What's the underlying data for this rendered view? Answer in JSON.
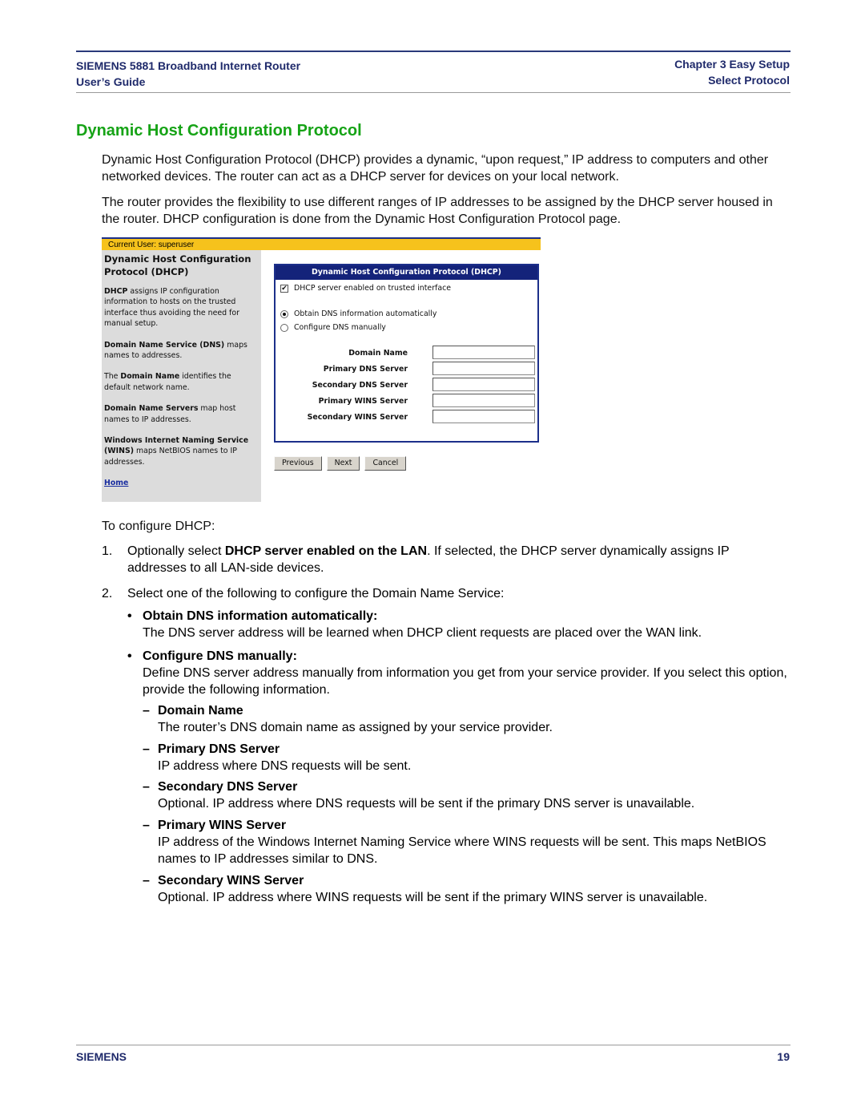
{
  "header": {
    "left_line1": "SIEMENS 5881 Broadband Internet Router",
    "left_line2": "User’s Guide",
    "right_line1": "Chapter 3  Easy Setup",
    "right_line2": "Select Protocol"
  },
  "section_title": "Dynamic Host Configuration Protocol",
  "intro": [
    "Dynamic Host Configuration Protocol (DHCP) provides a dynamic, “upon request,” IP address to computers and other networked devices. The router can act as a DHCP server for devices on your local network.",
    "The router provides the flexibility to use different ranges of IP addresses to be assigned by the DHCP server housed in the router. DHCP configuration is done from the Dynamic Host Configuration Protocol page."
  ],
  "screenshot": {
    "current_user": "Current User: superuser",
    "sidebar": {
      "title": "Dynamic Host Configuration Protocol (DHCP)",
      "paragraphs": [
        {
          "bold": "DHCP",
          "text": " assigns IP configuration information to hosts on the trusted interface thus avoiding the need for manual setup."
        },
        {
          "bold": "Domain Name Service (DNS)",
          "text": " maps names to addresses."
        },
        {
          "prefix": "The ",
          "bold": "Domain Name",
          "text": " identifies the default network name."
        },
        {
          "bold": "Domain Name Servers",
          "text": " map host names to IP addresses."
        },
        {
          "bold": "Windows Internet Naming Service (WINS)",
          "text": " maps NetBIOS names to IP addresses."
        }
      ],
      "home_link": "Home"
    },
    "panel": {
      "title": "Dynamic Host Configuration Protocol (DHCP)",
      "dhcp_checkbox_label": "DHCP server enabled on trusted interface",
      "dhcp_checkbox_checked": true,
      "radio_auto_label": "Obtain DNS information automatically",
      "radio_manual_label": "Configure DNS manually",
      "selected_radio": "auto",
      "fields": [
        {
          "label": "Domain Name",
          "value": ""
        },
        {
          "label": "Primary DNS Server",
          "value": ""
        },
        {
          "label": "Secondary DNS Server",
          "value": ""
        },
        {
          "label": "Primary WINS Server",
          "value": ""
        },
        {
          "label": "Secondary WINS Server",
          "value": ""
        }
      ]
    },
    "buttons": {
      "previous": "Previous",
      "next": "Next",
      "cancel": "Cancel"
    }
  },
  "configure_intro": "To configure DHCP:",
  "steps": [
    {
      "num": "1.",
      "pre": "Optionally select ",
      "bold": "DHCP server enabled on the LAN",
      "post": ". If selected, the DHCP server dynamically assigns IP addresses to all LAN-side devices."
    },
    {
      "num": "2.",
      "text": "Select one of the following to configure the Domain Name Service:"
    }
  ],
  "bullets": [
    {
      "head": "Obtain DNS information automatically:",
      "text": "The DNS server address will be learned when DHCP client requests are placed over the WAN link."
    },
    {
      "head": "Configure DNS manually:",
      "text": "Define DNS server address manually from information you get from your service provider. If you select this option, provide the following information."
    }
  ],
  "fields_desc": [
    {
      "head": "Domain Name",
      "text": "The router’s DNS domain name as assigned by your service provider."
    },
    {
      "head": "Primary DNS Server",
      "text": "IP address where DNS requests will be sent."
    },
    {
      "head": "Secondary DNS Server",
      "text": "Optional. IP address where DNS requests will be sent if the primary DNS server is unavailable."
    },
    {
      "head": "Primary WINS Server",
      "text": "IP address of the Windows Internet Naming Service where WINS requests will be sent. This maps NetBIOS names to IP addresses similar to DNS."
    },
    {
      "head": "Secondary WINS Server",
      "text": "Optional. IP address where WINS requests will be sent if the primary WINS server is unavailable."
    }
  ],
  "footer": {
    "brand": "SIEMENS",
    "page_number": "19"
  },
  "symbols": {
    "bullet": "•",
    "dash": "–",
    "check": "✔"
  },
  "colors": {
    "header_text": "#1f2a6b",
    "section_title": "#16a316",
    "topbar_yellow": "#f6c21c",
    "panel_navy": "#14237a"
  }
}
